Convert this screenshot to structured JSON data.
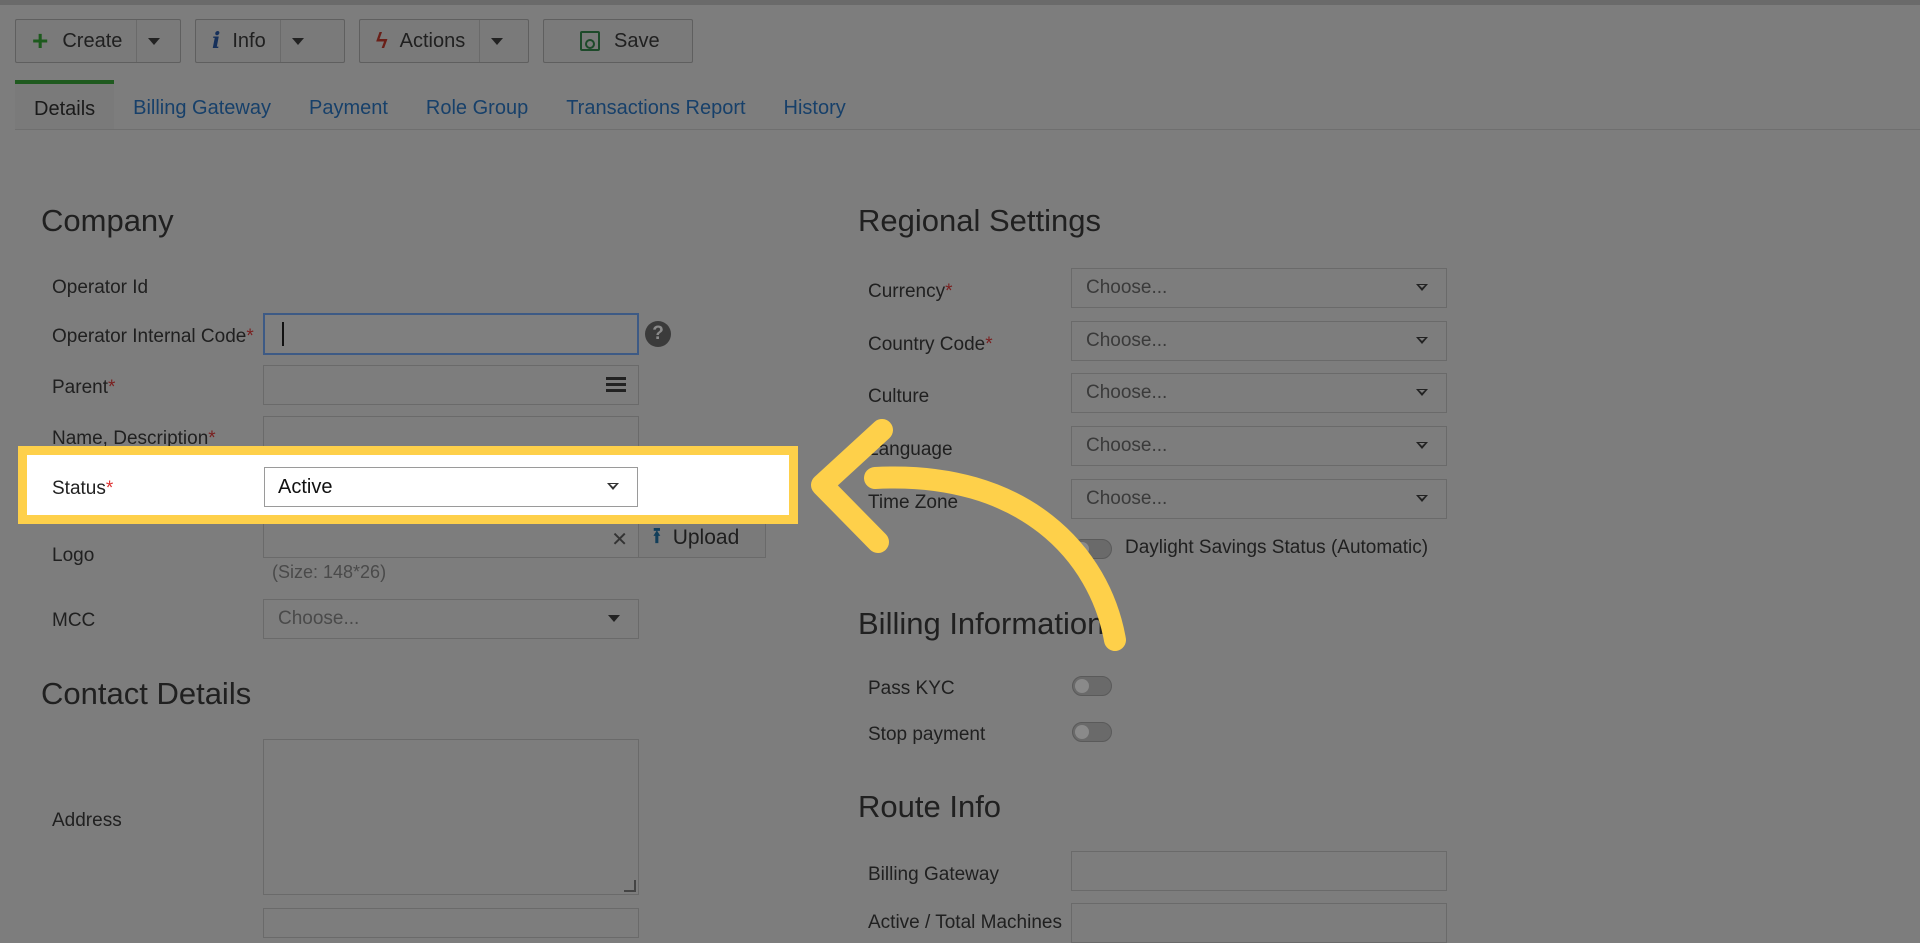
{
  "toolbar": {
    "create_label": "Create",
    "info_label": "Info",
    "actions_label": "Actions",
    "save_label": "Save"
  },
  "tabs": [
    {
      "label": "Details",
      "active": true
    },
    {
      "label": "Billing Gateway"
    },
    {
      "label": "Payment"
    },
    {
      "label": "Role Group"
    },
    {
      "label": "Transactions Report"
    },
    {
      "label": "History"
    }
  ],
  "company": {
    "heading": "Company",
    "operator_id_label": "Operator Id",
    "operator_internal_code_label": "Operator Internal Code",
    "parent_label": "Parent",
    "name_description_label": "Name, Description",
    "status_label": "Status",
    "status_value": "Active",
    "logo_label": "Logo",
    "upload_label": "Upload",
    "logo_size_hint": "(Size: 148*26)",
    "mcc_label": "MCC",
    "mcc_placeholder": "Choose..."
  },
  "contact": {
    "heading": "Contact Details",
    "address_label": "Address"
  },
  "regional": {
    "heading": "Regional Settings",
    "currency_label": "Currency",
    "currency_value": "Choose...",
    "country_code_label": "Country Code",
    "country_code_value": "Choose...",
    "culture_label": "Culture",
    "culture_value": "Choose...",
    "language_label": "Language",
    "language_value": "Choose...",
    "time_zone_label": "Time Zone",
    "time_zone_value": "Choose...",
    "daylight_label": "Daylight Savings Status (Automatic)"
  },
  "billing": {
    "heading": "Billing Information",
    "pass_kyc_label": "Pass KYC",
    "stop_payment_label": "Stop payment"
  },
  "route": {
    "heading": "Route Info",
    "billing_gateway_label": "Billing Gateway",
    "active_total_label": "Active / Total Machines"
  },
  "colors": {
    "highlight": "#fed04a",
    "overlay": "#7d7d7d"
  }
}
